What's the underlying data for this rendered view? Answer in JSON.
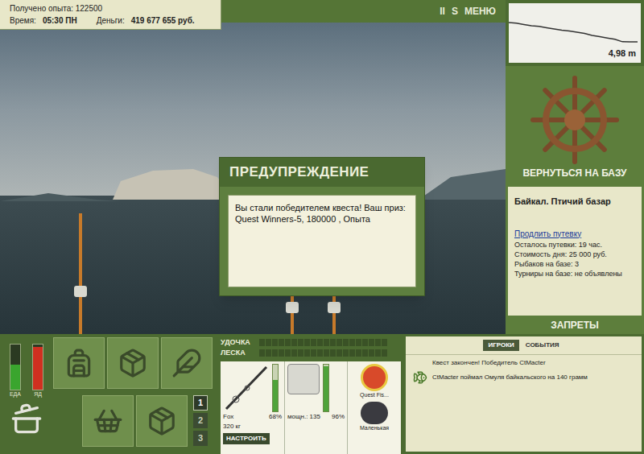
{
  "stats": {
    "experience": "Получено опыта: 122500",
    "time_label": "Время:",
    "time": "05:30 ПН",
    "money_label": "Деньги:",
    "money": "419 677 655 руб."
  },
  "top_buttons": [
    "II",
    "S",
    "МЕНЮ"
  ],
  "depth": {
    "reading": "4,98 m",
    "values": [
      2.0,
      2.1,
      2.3,
      2.5,
      2.6,
      2.8,
      3.0,
      3.2,
      3.3,
      3.5,
      3.7,
      4.0,
      4.2,
      4.4,
      4.6,
      4.98,
      5.0,
      5.0
    ]
  },
  "dialog": {
    "title": "ПРЕДУПРЕЖДЕНИЕ",
    "message": "Вы стали победителем квеста! Ваш приз: Quest Winners-5, 180000 , Опыта"
  },
  "base": {
    "button": "ВЕРНУТЬСЯ НА БАЗУ",
    "name": "Байкал. Птичий базар",
    "extend_link": "Продлить путевку",
    "details": [
      "Осталось путевки: 19 час.",
      "Стоимость дня: 25 000 руб.",
      "Рыбаков на базе: 3",
      "Турниры на базе: не объявлены"
    ],
    "bans": "ЗАПРЕТЫ"
  },
  "meters": [
    {
      "label": "ЕДА",
      "level": 0.55,
      "color": "#3aa52e"
    },
    {
      "label": "ЯД",
      "level": 0.95,
      "color": "#d03020"
    }
  ],
  "slots": [
    {
      "label": "1",
      "selected": true
    },
    {
      "label": "2",
      "selected": false
    },
    {
      "label": "3",
      "selected": false
    }
  ],
  "gauges": [
    {
      "label": "УДОЧКА",
      "level": 0
    },
    {
      "label": "ЛЕСКА",
      "level": 0
    }
  ],
  "rod": {
    "name": "Fox",
    "weight": "320 кг",
    "wear": "68%",
    "level": 0.68,
    "button": "НАСТРОИТЬ"
  },
  "reel": {
    "power": "мощн.: 135",
    "wear": "96%",
    "level": 0.96
  },
  "lure": {
    "name": "Quest Fis..."
  },
  "bait": {
    "name": "Маленькая"
  },
  "chat": {
    "tabs": [
      {
        "label": "ИГРОКИ",
        "selected": true
      },
      {
        "label": "СОБЫТИЯ",
        "selected": false
      }
    ],
    "messages": [
      {
        "text": "Квест закончен! Победитель CtMacter",
        "has_fish_icon": false
      },
      {
        "text": "CtMacter поймал Омуля байкальского на 140 грамм",
        "has_fish_icon": true
      }
    ]
  }
}
